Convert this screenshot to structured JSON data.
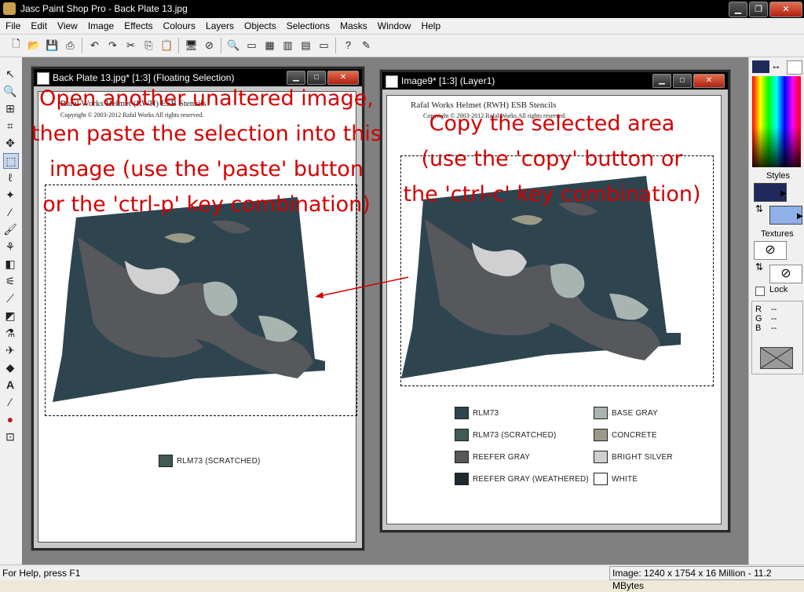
{
  "app": {
    "title": "Jasc Paint Shop Pro - Back Plate 13.jpg"
  },
  "menu": [
    "File",
    "Edit",
    "View",
    "Image",
    "Effects",
    "Colours",
    "Layers",
    "Objects",
    "Selections",
    "Masks",
    "Window",
    "Help"
  ],
  "window_left": {
    "title": "Back Plate 13.jpg* [1:3] (Floating Selection)",
    "header_line1": "Rafal Works Helmet (RWH) ESB Stencils",
    "header_line2": "Copyright © 2003-2012 Rafal Works All rights reserved.",
    "swatch": {
      "label": "RLM73 (SCRATCHED)",
      "color": "#3f5a56"
    }
  },
  "window_right": {
    "title": "Image9* [1:3] (Layer1)",
    "header_line1": "Rafal Works Helmet (RWH) ESB Stencils",
    "header_line2": "Copyright © 2003-2012 Rafal Works All rights reserved.",
    "swatches_left": [
      {
        "label": "RLM73",
        "color": "#2e4550"
      },
      {
        "label": "RLM73 (SCRATCHED)",
        "color": "#3f5a56"
      },
      {
        "label": "REEFER GRAY",
        "color": "#56585c"
      },
      {
        "label": "REEFER GRAY (WEATHERED)",
        "color": "#1e2a30"
      }
    ],
    "swatches_right": [
      {
        "label": "BASE GRAY",
        "color": "#a8b4b0"
      },
      {
        "label": "CONCRETE",
        "color": "#9a9a86"
      },
      {
        "label": "BRIGHT SILVER",
        "color": "#d0d0d0"
      },
      {
        "label": "WHITE",
        "color": "#ffffff"
      }
    ]
  },
  "annotations": {
    "left": [
      "Open another unaltered image,",
      "then paste the selection into this",
      "image (use the 'paste' button",
      "or the 'ctrl-p' key combination)"
    ],
    "right": [
      "Copy the selected area",
      "(use the 'copy' button or",
      "the 'ctrl-c' key combination)"
    ]
  },
  "right_panel": {
    "styles_label": "Styles",
    "textures_label": "Textures",
    "lock_label": "Lock",
    "rgb": [
      {
        "k": "R",
        "v": "--"
      },
      {
        "k": "G",
        "v": "--"
      },
      {
        "k": "B",
        "v": "--"
      }
    ],
    "foreground_color": "#1f2a5a",
    "background_color": "#8fb0e8"
  },
  "status": {
    "help": "For Help, press F1",
    "image_info": "Image:  1240 x 1754 x 16 Million - 11.2 MBytes"
  }
}
